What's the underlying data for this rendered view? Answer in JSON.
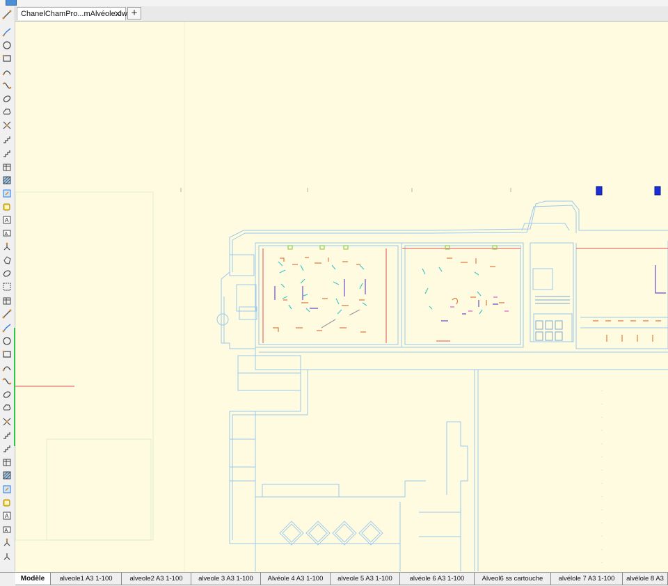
{
  "window": {
    "icon": "autocad-app-icon"
  },
  "document_tab": {
    "title": "ChanelChamPro...mAlvéole.dwg*",
    "close": "✕",
    "new_tab": "+"
  },
  "toolbar": {
    "tools": [
      "line-icon",
      "polyline-icon",
      "circle-icon",
      "rectangle-icon",
      "arc-icon",
      "spline-icon",
      "ellipse-icon",
      "revision-cloud-icon",
      "construction-line-icon",
      "point-icon",
      "stair-icon",
      "table-icon",
      "hatch-icon",
      "insert-block-icon",
      "region-icon",
      "text-icon",
      "mtext-icon",
      "tree-icon",
      "polygon-icon",
      "ellipse-icon",
      "wipeout-icon",
      "table-icon",
      "line-icon",
      "polyline-icon",
      "circle-icon",
      "rectangle-icon",
      "arc-icon",
      "spline-icon",
      "ellipse-icon",
      "revision-cloud-icon",
      "construction-line-icon",
      "point-icon",
      "stair-icon",
      "table-icon",
      "hatch-icon",
      "insert-block-icon",
      "region-icon",
      "text-icon",
      "mtext-icon",
      "tree-icon",
      "select-icon"
    ]
  },
  "colors": {
    "canvas": "#fefbe1",
    "walls": "#9cc8ea",
    "furniture_orange": "#e07a3c",
    "furniture_cyan": "#3cc8c8",
    "furniture_purple": "#6a4bc4",
    "marker_blue": "#1a2fd4",
    "redline": "#e05050"
  },
  "layout_tabs": [
    {
      "label": "Modèle",
      "active": true
    },
    {
      "label": "alveole1 A3 1-100",
      "active": false
    },
    {
      "label": "alveole2 A3 1-100",
      "active": false
    },
    {
      "label": "alveole 3 A3 1-100",
      "active": false
    },
    {
      "label": "Alvéole 4 A3 1-100",
      "active": false
    },
    {
      "label": "alveole 5 A3 1-100",
      "active": false
    },
    {
      "label": "alvéole 6 A3 1-100",
      "active": false
    },
    {
      "label": "Alveol6 ss cartouche",
      "active": false
    },
    {
      "label": "alvélole 7 A3 1-100",
      "active": false
    },
    {
      "label": "alvélole 8 A3",
      "active": false
    }
  ]
}
